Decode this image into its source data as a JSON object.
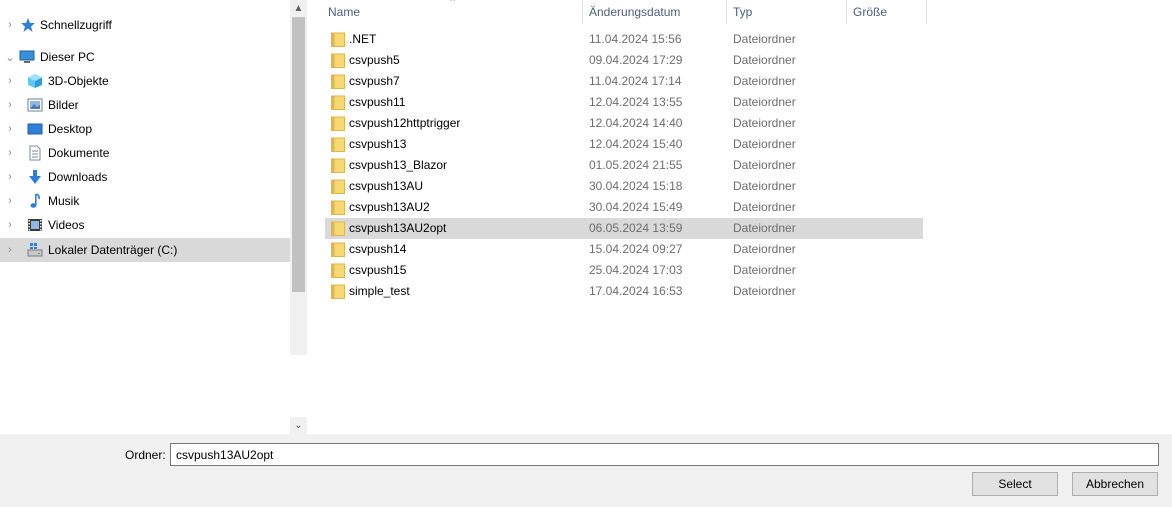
{
  "nav": {
    "items": [
      {
        "label": "Schnellzugriff",
        "icon": "star-icon"
      },
      {
        "label": "Dieser PC",
        "icon": "computer-icon"
      },
      {
        "label": "3D-Objekte",
        "icon": "cube-icon"
      },
      {
        "label": "Bilder",
        "icon": "pictures-icon"
      },
      {
        "label": "Desktop",
        "icon": "desktop-icon"
      },
      {
        "label": "Dokumente",
        "icon": "document-icon"
      },
      {
        "label": "Downloads",
        "icon": "download-arrow-icon"
      },
      {
        "label": "Musik",
        "icon": "music-note-icon"
      },
      {
        "label": "Videos",
        "icon": "film-icon"
      },
      {
        "label": "Lokaler Datenträger (C:)",
        "icon": "drive-icon"
      }
    ],
    "selected": "Lokaler Datenträger (C:)"
  },
  "list": {
    "columns": {
      "name": "Name",
      "date": "Änderungsdatum",
      "type": "Typ",
      "size": "Größe"
    },
    "rows": [
      {
        "name": ".NET",
        "date": "11.04.2024 15:56",
        "type": "Dateiordner"
      },
      {
        "name": "csvpush5",
        "date": "09.04.2024 17:29",
        "type": "Dateiordner"
      },
      {
        "name": "csvpush7",
        "date": "11.04.2024 17:14",
        "type": "Dateiordner"
      },
      {
        "name": "csvpush11",
        "date": "12.04.2024 13:55",
        "type": "Dateiordner"
      },
      {
        "name": "csvpush12httptrigger",
        "date": "12.04.2024 14:40",
        "type": "Dateiordner"
      },
      {
        "name": "csvpush13",
        "date": "12.04.2024 15:40",
        "type": "Dateiordner"
      },
      {
        "name": "csvpush13_Blazor",
        "date": "01.05.2024 21:55",
        "type": "Dateiordner"
      },
      {
        "name": "csvpush13AU",
        "date": "30.04.2024 15:18",
        "type": "Dateiordner"
      },
      {
        "name": "csvpush13AU2",
        "date": "30.04.2024 15:49",
        "type": "Dateiordner"
      },
      {
        "name": "csvpush13AU2opt",
        "date": "06.05.2024 13:59",
        "type": "Dateiordner"
      },
      {
        "name": "csvpush14",
        "date": "15.04.2024 09:27",
        "type": "Dateiordner"
      },
      {
        "name": "csvpush15",
        "date": "25.04.2024 17:03",
        "type": "Dateiordner"
      },
      {
        "name": "simple_test",
        "date": "17.04.2024 16:53",
        "type": "Dateiordner"
      }
    ],
    "selected": "csvpush13AU2opt"
  },
  "bottom": {
    "folder_label": "Ordner:",
    "folder_value": "csvpush13AU2opt",
    "select_label": "Select",
    "cancel_label": "Abbrechen"
  },
  "colors": {
    "selection": "#d9d9d9",
    "folder_yellow": "#f8d775",
    "folder_dark": "#e0b64a",
    "header_text": "#4c607a"
  }
}
